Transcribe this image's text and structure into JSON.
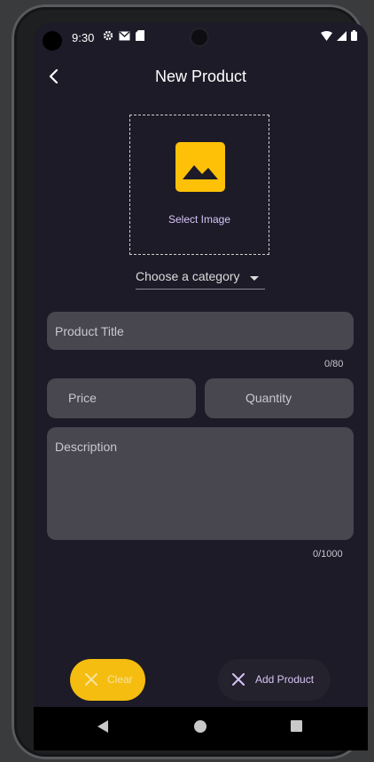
{
  "status": {
    "time": "9:30"
  },
  "appbar": {
    "title": "New Product",
    "back_icon": "back-arrow-icon"
  },
  "image_picker": {
    "label": "Select Image",
    "icon": "image-icon",
    "icon_color": "#FFC107"
  },
  "category": {
    "placeholder": "Choose a category"
  },
  "form": {
    "title": {
      "placeholder": "Product Title",
      "counter": "0/80"
    },
    "price": {
      "placeholder": "Price"
    },
    "quantity": {
      "placeholder": "Quantity"
    },
    "description": {
      "placeholder": "Description",
      "counter": "0/1000"
    }
  },
  "actions": {
    "clear_label": "Clear",
    "add_label": "Add Product",
    "clear_color": "#F5BD0F"
  },
  "colors": {
    "background": "#1C1B27",
    "field": "#48464F",
    "accent": "#D7C5F7"
  }
}
